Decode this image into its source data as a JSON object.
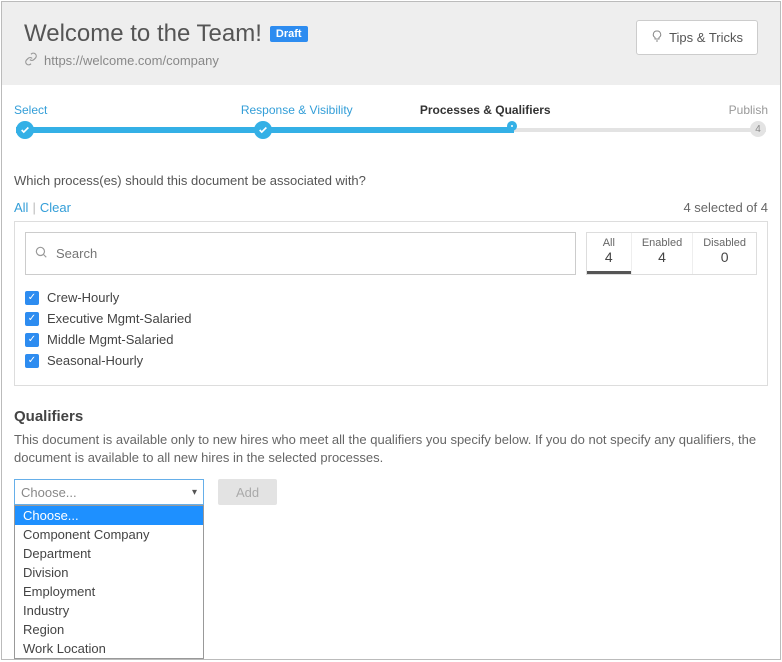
{
  "header": {
    "title": "Welcome to the Team!",
    "status_badge": "Draft",
    "source_url": "https://welcome.com/company",
    "tips_button": "Tips & Tricks"
  },
  "stepper": {
    "steps": [
      {
        "label": "Select"
      },
      {
        "label": "Response & Visibility"
      },
      {
        "label": "Processes & Qualifiers"
      },
      {
        "label": "Publish"
      }
    ],
    "last_index": "4"
  },
  "processes": {
    "question": "Which process(es) should this document be associated with?",
    "all_link": "All",
    "clear_link": "Clear",
    "selected_text": "4 selected of 4",
    "search_placeholder": "Search",
    "tabs": {
      "all_label": "All",
      "all_count": "4",
      "enabled_label": "Enabled",
      "enabled_count": "4",
      "disabled_label": "Disabled",
      "disabled_count": "0"
    },
    "items": [
      {
        "label": "Crew-Hourly"
      },
      {
        "label": "Executive Mgmt-Salaried"
      },
      {
        "label": "Middle Mgmt-Salaried"
      },
      {
        "label": "Seasonal-Hourly"
      }
    ]
  },
  "qualifiers": {
    "heading": "Qualifiers",
    "description": "This document is available only to new hires who meet all the qualifiers you specify below. If you do not specify any qualifiers, the document is available to all new hires in the selected processes.",
    "select_placeholder": "Choose...",
    "add_button": "Add",
    "options": [
      "Choose...",
      "Component Company",
      "Department",
      "Division",
      "Employment",
      "Industry",
      "Region",
      "Work Location"
    ]
  }
}
